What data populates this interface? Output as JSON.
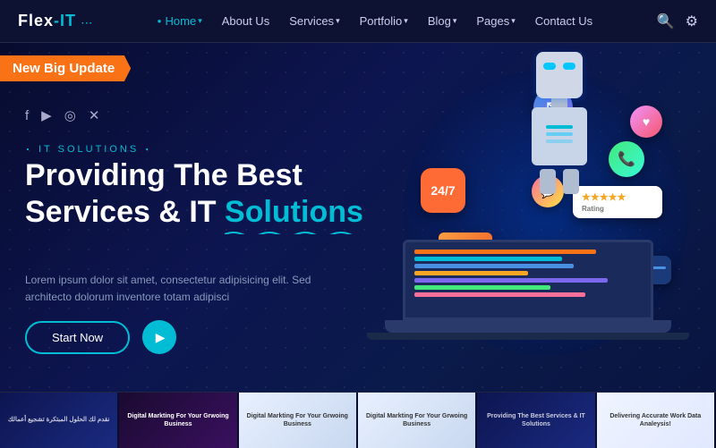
{
  "brand": {
    "name": "Flex-IT",
    "tagline": "Flex",
    "tagline2": "IT"
  },
  "nav": {
    "links": [
      {
        "label": "Home",
        "active": true
      },
      {
        "label": "About Us",
        "active": false
      },
      {
        "label": "Services",
        "active": false
      },
      {
        "label": "Portfolio",
        "active": false
      },
      {
        "label": "Blog",
        "active": false
      },
      {
        "label": "Pages",
        "active": false
      },
      {
        "label": "Contact Us",
        "active": false
      }
    ]
  },
  "badge": {
    "text": "New Big Update"
  },
  "hero": {
    "it_label": "IT SOLUTIONS",
    "headline_line1": "Providing The Best",
    "headline_line2": "Services & IT ",
    "headline_highlight": "Solutions",
    "body_text": "Lorem ipsum dolor sit amet, consectetur adipisicing elit. Sed architecto dolorum inventore totam adipisci",
    "cta_button": "Start Now",
    "play_button_label": "Play"
  },
  "thumbs": [
    {
      "text": "نقدم لك الحلول المبتكرة تشجيع أعمالك"
    },
    {
      "text": "Digital Markting For Your Grwoing Business"
    },
    {
      "text": "Digital Markting For Your Grwoing Business"
    },
    {
      "text": "Digital Markting For Your Grwoing Business"
    },
    {
      "text": "Providing The Best Services & IT Solutions"
    },
    {
      "text": "Delivering Accurate Work Data Analeysis!"
    }
  ],
  "floating": {
    "card_247": "24/7",
    "stars": "★★★★★",
    "rating_label": "Rating"
  }
}
